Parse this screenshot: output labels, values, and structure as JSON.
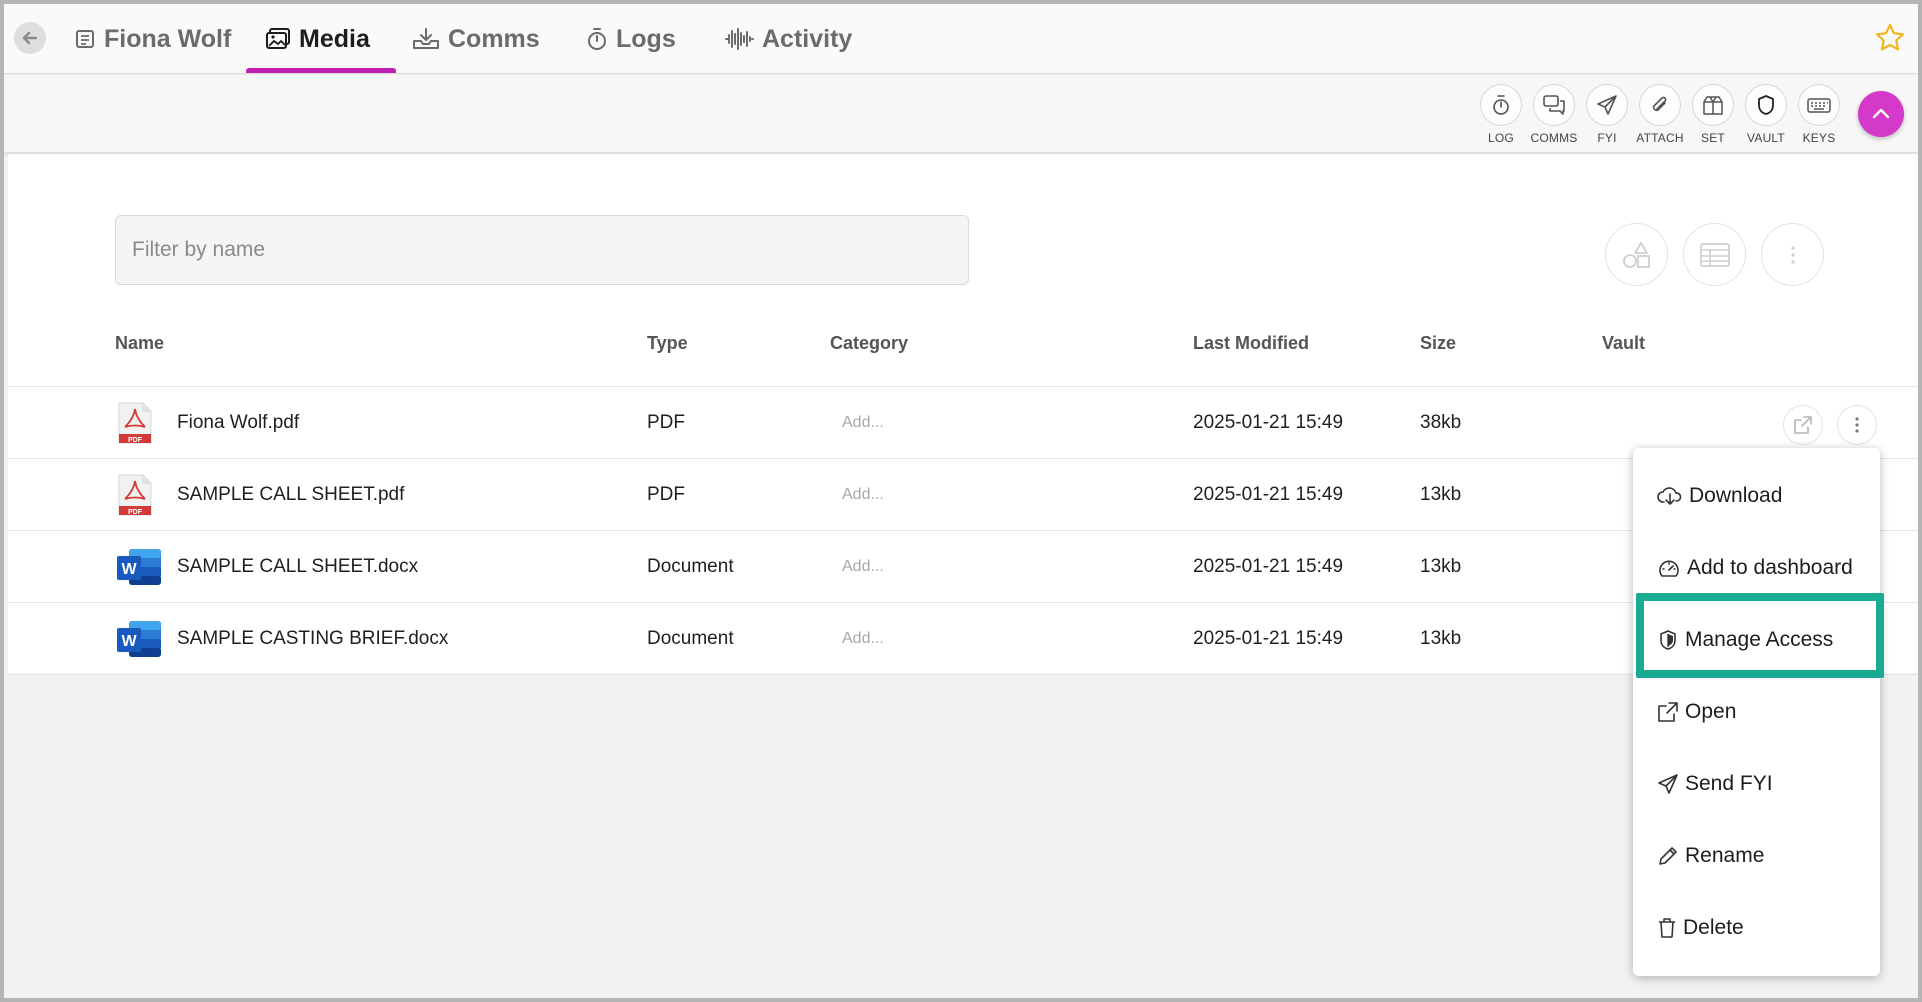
{
  "tabs": [
    {
      "label": "Fiona Wolf",
      "icon": "document-icon"
    },
    {
      "label": "Media",
      "icon": "image-icon",
      "active": true
    },
    {
      "label": "Comms",
      "icon": "inbox-download-icon"
    },
    {
      "label": "Logs",
      "icon": "stopwatch-icon"
    },
    {
      "label": "Activity",
      "icon": "waveform-icon"
    }
  ],
  "toolbar": [
    {
      "label": "LOG",
      "icon": "stopwatch-icon"
    },
    {
      "label": "COMMS",
      "icon": "chat-bubbles-icon"
    },
    {
      "label": "FYI",
      "icon": "paper-plane-icon"
    },
    {
      "label": "ATTACH",
      "icon": "paperclip-icon"
    },
    {
      "label": "SET",
      "icon": "box-icon"
    },
    {
      "label": "VAULT",
      "icon": "shield-icon"
    },
    {
      "label": "KEYS",
      "icon": "keyboard-icon"
    }
  ],
  "filter": {
    "placeholder": "Filter by name",
    "value": ""
  },
  "columns": [
    "Name",
    "Type",
    "Category",
    "Last Modified",
    "Size",
    "Vault"
  ],
  "files": [
    {
      "name": "Fiona Wolf.pdf",
      "type": "PDF",
      "category": "Add...",
      "modified": "2025-01-21 15:49",
      "size": "38kb",
      "icon": "pdf-file-icon"
    },
    {
      "name": "SAMPLE CALL SHEET.pdf",
      "type": "PDF",
      "category": "Add...",
      "modified": "2025-01-21 15:49",
      "size": "13kb",
      "icon": "pdf-file-icon"
    },
    {
      "name": "SAMPLE CALL SHEET.docx",
      "type": "Document",
      "category": "Add...",
      "modified": "2025-01-21 15:49",
      "size": "13kb",
      "icon": "word-file-icon"
    },
    {
      "name": "SAMPLE CASTING BRIEF.docx",
      "type": "Document",
      "category": "Add...",
      "modified": "2025-01-21 15:49",
      "size": "13kb",
      "icon": "word-file-icon"
    }
  ],
  "pdf_badge": "PDF",
  "word_badge": "W",
  "context_menu": [
    {
      "label": "Download",
      "icon": "cloud-download-icon"
    },
    {
      "label": "Add to dashboard",
      "icon": "dashboard-gauge-icon"
    },
    {
      "label": "Manage Access",
      "icon": "shield-check-icon",
      "highlighted": true
    },
    {
      "label": "Open",
      "icon": "external-link-icon"
    },
    {
      "label": "Send FYI",
      "icon": "paper-plane-icon"
    },
    {
      "label": "Rename",
      "icon": "pencil-icon"
    },
    {
      "label": "Delete",
      "icon": "trash-icon"
    }
  ],
  "colors": {
    "accent": "#c21fb5",
    "fab": "#d439c9",
    "highlight": "#1aab93",
    "star": "#f2b41f"
  }
}
